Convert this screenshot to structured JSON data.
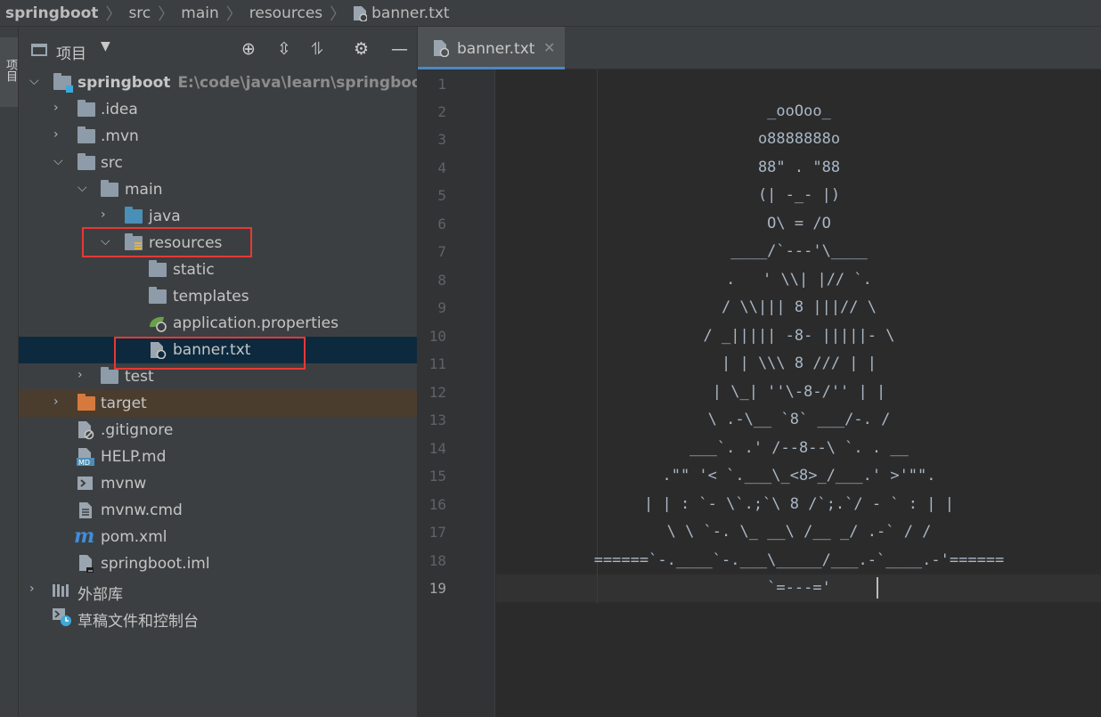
{
  "breadcrumb": [
    "springboot",
    "src",
    "main",
    "resources",
    "banner.txt"
  ],
  "side_stripe_label": "项目",
  "project_panel": {
    "title": "项目",
    "toolbar_icons": [
      "locate-icon",
      "expand-all-icon",
      "collapse-all-icon",
      "gear-icon",
      "minimize-icon"
    ]
  },
  "tree": [
    {
      "label": "springboot",
      "path": "E:\\code\\java\\learn\\springboot"
    },
    {
      "label": ".idea"
    },
    {
      "label": ".mvn"
    },
    {
      "label": "src"
    },
    {
      "label": "main"
    },
    {
      "label": "java"
    },
    {
      "label": "resources"
    },
    {
      "label": "static"
    },
    {
      "label": "templates"
    },
    {
      "label": "application.properties"
    },
    {
      "label": "banner.txt"
    },
    {
      "label": "test"
    },
    {
      "label": "target"
    },
    {
      "label": ".gitignore"
    },
    {
      "label": "HELP.md"
    },
    {
      "label": "mvnw"
    },
    {
      "label": "mvnw.cmd"
    },
    {
      "label": "pom.xml"
    },
    {
      "label": "springboot.iml"
    },
    {
      "label": "外部库"
    },
    {
      "label": "草稿文件和控制台"
    }
  ],
  "editor": {
    "tab_label": "banner.txt",
    "current_line": 19,
    "line_numbers": [
      "1",
      "2",
      "3",
      "4",
      "5",
      "6",
      "7",
      "8",
      "9",
      "10",
      "11",
      "12",
      "13",
      "14",
      "15",
      "16",
      "17",
      "18",
      "19"
    ],
    "lines": [
      "",
      "_ooOoo_",
      "o8888888o",
      "88\" . \"88",
      "(| -_- |)",
      "O\\ = /O",
      "____/`---'\\____",
      ".   ' \\\\| |// `.",
      "/ \\\\||| 8 |||// \\",
      "/ _||||| -8- |||||- \\",
      "| | \\\\\\ 8 /// | |",
      "| \\_| ''\\-8-/'' | |",
      "\\ .-\\__ `8` ___/-. /",
      "___`. .' /--8--\\ `. . __",
      ".\"\" '< `.___\\_<8>_/___.' >'\"\".",
      "| | : `- \\`.;`\\ 8 /`;.`/ - ` : | |",
      "\\ \\ `-. \\_ __\\ /__ _/ .-` / /",
      "======`-.____`-.___\\_____/___.-`____.-'======",
      "`=---='"
    ]
  }
}
